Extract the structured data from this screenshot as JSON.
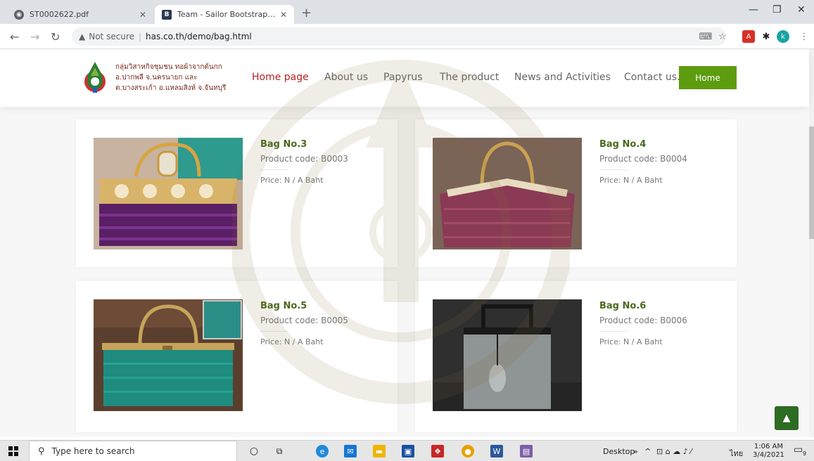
{
  "browser": {
    "tabs": [
      {
        "title": "ST0002622.pdf",
        "active": false
      },
      {
        "title": "Team - Sailor Bootstrap Template",
        "active": true
      }
    ],
    "not_secure": "Not secure",
    "url": "has.co.th/demo/bag.html",
    "profile_initial": "k"
  },
  "site": {
    "brand_lines": [
      "กลุ่มวิสาหกิจชุมชน ทอผ้าจากต้นกก",
      "อ.ปากพลี จ.นครนายก และ",
      "ต.บางสระเก้า อ.แหลมสิงห์ จ.จันทบุรี"
    ],
    "nav": [
      "Home page",
      "About us",
      "Papyrus",
      "The product",
      "News and Activities",
      "Contact us."
    ],
    "home_button": "Home"
  },
  "products": [
    {
      "name": "Bag No.3",
      "code": "Product code: B0003",
      "price": "Price: N / A Baht"
    },
    {
      "name": "Bag No.4",
      "code": "Product code: B0004",
      "price": "Price: N / A Baht"
    },
    {
      "name": "Bag No.5",
      "code": "Product code: B0005",
      "price": "Price: N / A Baht"
    },
    {
      "name": "Bag No.6",
      "code": "Product code: B0006",
      "price": "Price: N / A Baht"
    }
  ],
  "taskbar": {
    "search_placeholder": "Type here to search",
    "desktop": "Desktop",
    "lang": "ไทย",
    "time": "1:06 AM",
    "date": "3/4/2021",
    "notifications": "9"
  }
}
